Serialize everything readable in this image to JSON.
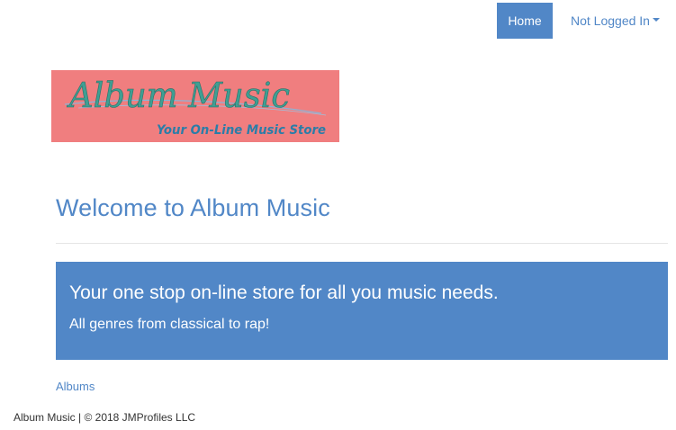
{
  "colors": {
    "primary": "#5187c7",
    "logo_bg": "#f07e7f",
    "logo_title": "#3f9f93",
    "logo_tagline": "#2b7da8"
  },
  "nav": {
    "home_label": "Home",
    "user_label": "Not Logged In",
    "user_icon": "caret-down-icon"
  },
  "logo": {
    "title": "Album Music",
    "tagline": "Your On-Line Music Store"
  },
  "main": {
    "heading": "Welcome to Album Music",
    "banner_lead": "Your one stop on-line store for all you music needs.",
    "banner_sub": "All genres from classical to rap!",
    "albums_link": "Albums"
  },
  "footer": {
    "text": "Album Music | © 2018 JMProfiles LLC"
  }
}
